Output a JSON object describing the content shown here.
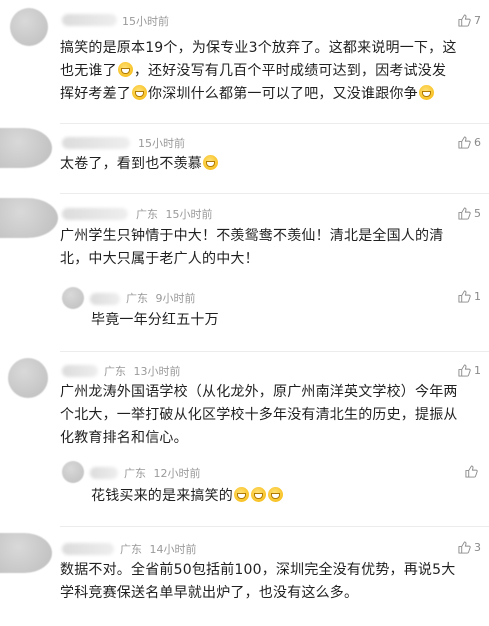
{
  "comments": [
    {
      "time": "15小时前",
      "location": "",
      "likes": "7",
      "lines": [
        "搞笑的是原本19个，为保专业3个放弃了。这都来说明一下，这",
        "也无谁了{e}，还好没写有几百个平时成绩可达到，因考试没发",
        "挥好考差了{e}你深圳什么都第一可以了吧，又没谁跟你争{e}"
      ]
    },
    {
      "time": "15小时前",
      "location": "",
      "likes": "6",
      "lines": [
        "太卷了，看到也不羡慕{e}"
      ]
    },
    {
      "time": "15小时前",
      "location": "广东",
      "likes": "5",
      "lines": [
        "广州学生只钟情于中大！不羡鸳鸯不羡仙！清北是全国人的清",
        "北，中大只属于老广人的中大！"
      ]
    },
    {
      "time": "9小时前",
      "location": "广东",
      "likes": "1",
      "lines": [
        "毕竟一年分红五十万"
      ]
    },
    {
      "time": "13小时前",
      "location": "广东",
      "likes": "1",
      "lines": [
        "广州龙涛外国语学校（从化龙外，原广州南洋英文学校）今年两",
        "个北大，一举打破从化区学校十多年没有清北生的历史，提振从",
        "化教育排名和信心。"
      ]
    },
    {
      "time": "12小时前",
      "location": "广东",
      "likes": "",
      "lines": [
        "花钱买来的是来搞笑的{e}{e}{e}"
      ]
    },
    {
      "time": "14小时前",
      "location": "广东",
      "likes": "3",
      "lines": [
        "数据不对。全省前50包括前100，深圳完全没有优势，再说5大",
        "学科竞赛保送名单早就出炉了，也没有这么多。"
      ]
    }
  ]
}
